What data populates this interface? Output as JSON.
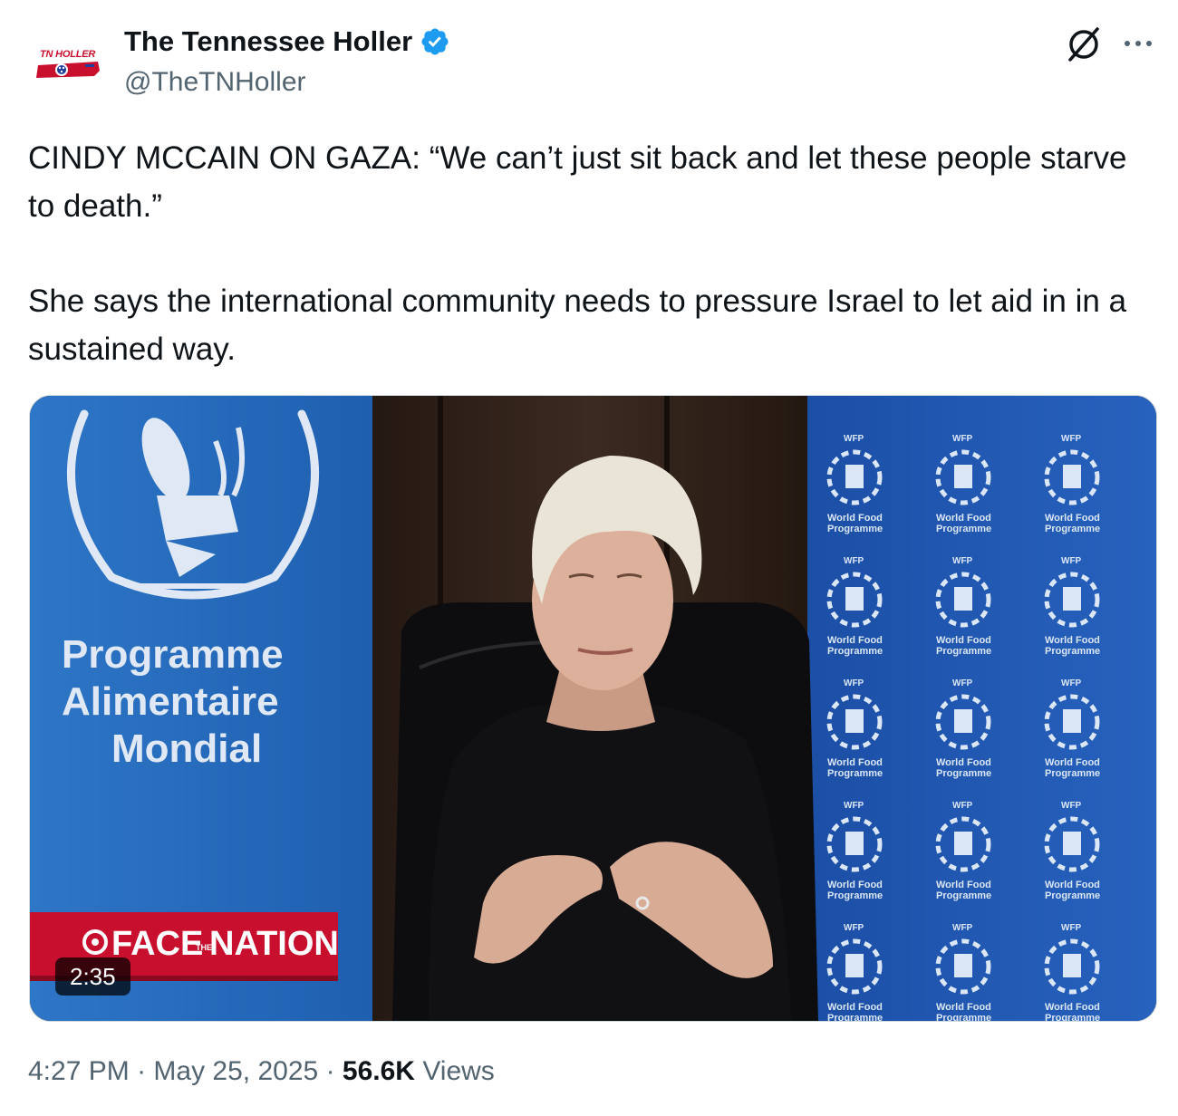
{
  "author": {
    "display_name": "The Tennessee Holler",
    "handle": "@TheTNHoller",
    "avatar_text": "TN HOLLER",
    "verified_color": "#1d9bf0"
  },
  "actions": {
    "grok_icon": "grok-icon",
    "more_icon": "more-dots-icon"
  },
  "tweet": {
    "paragraph_1": "CINDY MCCAIN ON GAZA: “We can’t just sit back and let these people starve to death.”",
    "paragraph_2": "She says the international community needs to pressure Israel to let aid in in a sustained way."
  },
  "media": {
    "banner_line_1": "Programme",
    "banner_line_2": "Alimentaire",
    "banner_line_3": "Mondial",
    "show_logo": "FACE",
    "show_logo_small": "THE",
    "show_logo_end": "NATION",
    "backdrop_label_top": "WFP",
    "backdrop_label_line1": "World Food",
    "backdrop_label_line2": "Programme",
    "duration": "2:35"
  },
  "meta": {
    "time": "4:27 PM",
    "separator": "·",
    "date": "May 25, 2025",
    "views_count": "56.6K",
    "views_label": "Views"
  }
}
